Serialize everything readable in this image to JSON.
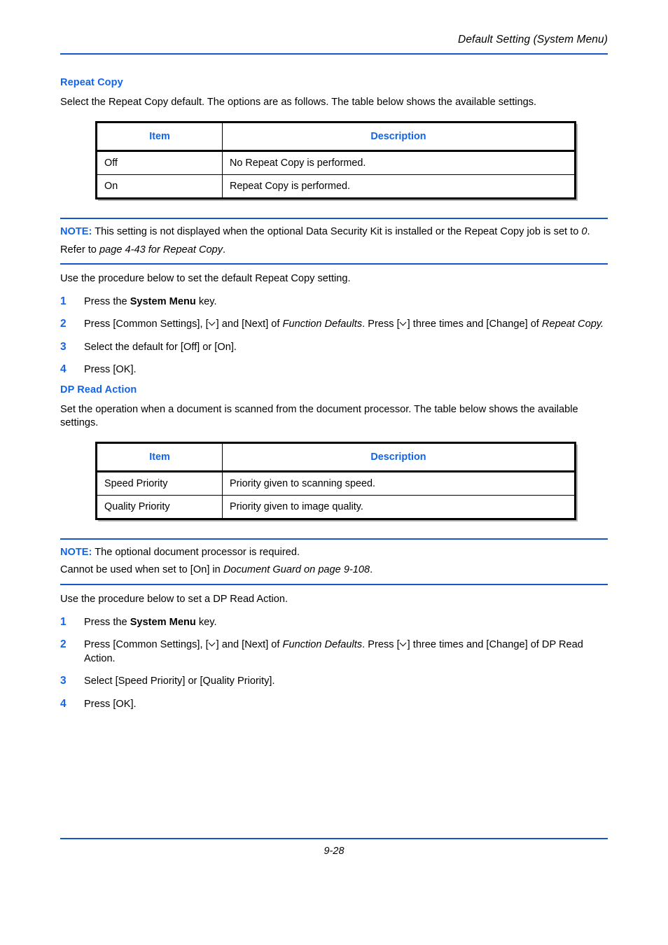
{
  "header": {
    "running_title": "Default Setting (System Menu)"
  },
  "footer": {
    "page_number": "9-28"
  },
  "sections": [
    {
      "heading": "Repeat Copy",
      "intro": "Select the Repeat Copy default. The options are as follows. The table below shows the available settings.",
      "table": {
        "columns": [
          "Item",
          "Description"
        ],
        "rows": [
          [
            "Off",
            "No Repeat Copy is performed."
          ],
          [
            "On",
            "Repeat Copy is performed."
          ]
        ]
      },
      "note": {
        "label": "NOTE:",
        "line1_a": " This setting is not displayed when the optional Data Security Kit is installed or the Repeat Copy job is set to ",
        "line1_italic": "0",
        "line1_b": ".",
        "line2_a": "Refer to ",
        "line2_italic": "page 4-43 for Repeat Copy",
        "line2_b": "."
      },
      "procedure_intro": "Use the procedure below to set the default Repeat Copy setting.",
      "steps": [
        {
          "number": "1",
          "parts": [
            {
              "text": "Press the ",
              "style": "normal"
            },
            {
              "text": "System Menu",
              "style": "bold"
            },
            {
              "text": " key.",
              "style": "normal"
            }
          ]
        },
        {
          "number": "2",
          "parts": [
            {
              "text": "Press [Common Settings], [",
              "style": "normal"
            },
            {
              "text": "",
              "style": "chevron"
            },
            {
              "text": "] and [Next] of ",
              "style": "normal"
            },
            {
              "text": "Function Defaults",
              "style": "italic"
            },
            {
              "text": ". Press [",
              "style": "normal"
            },
            {
              "text": "",
              "style": "chevron"
            },
            {
              "text": "] three times and [Change] of ",
              "style": "normal"
            },
            {
              "text": "Repeat Copy.",
              "style": "italic"
            }
          ]
        },
        {
          "number": "3",
          "parts": [
            {
              "text": "Select the default for [Off] or [On].",
              "style": "normal"
            }
          ]
        },
        {
          "number": "4",
          "parts": [
            {
              "text": "Press [OK].",
              "style": "normal"
            }
          ]
        }
      ]
    },
    {
      "heading": "DP Read Action",
      "intro": "Set the operation when a document is scanned from the document processor. The table below shows the available settings.",
      "table": {
        "columns": [
          "Item",
          "Description"
        ],
        "rows": [
          [
            "Speed Priority",
            "Priority given to scanning speed."
          ],
          [
            "Quality Priority",
            "Priority given to image quality."
          ]
        ]
      },
      "note": {
        "label": "NOTE:",
        "line1_a": " The optional document processor is required.",
        "line1_italic": "",
        "line1_b": "",
        "line2_a": "Cannot be used when set to [On] in ",
        "line2_italic": "Document Guard on page 9-108",
        "line2_b": "."
      },
      "procedure_intro": "Use the procedure below to set a DP Read Action.",
      "steps": [
        {
          "number": "1",
          "parts": [
            {
              "text": "Press the ",
              "style": "normal"
            },
            {
              "text": "System Menu",
              "style": "bold"
            },
            {
              "text": " key.",
              "style": "normal"
            }
          ]
        },
        {
          "number": "2",
          "parts": [
            {
              "text": "Press [Common Settings], [",
              "style": "normal"
            },
            {
              "text": "",
              "style": "chevron"
            },
            {
              "text": "] and [Next] of ",
              "style": "normal"
            },
            {
              "text": "Function Defaults",
              "style": "italic"
            },
            {
              "text": ". Press [",
              "style": "normal"
            },
            {
              "text": "",
              "style": "chevron"
            },
            {
              "text": "] three times and [Change] of DP Read Action.",
              "style": "normal"
            }
          ]
        },
        {
          "number": "3",
          "parts": [
            {
              "text": "Select [Speed Priority] or [Quality Priority].",
              "style": "normal"
            }
          ]
        },
        {
          "number": "4",
          "parts": [
            {
              "text": "Press [OK].",
              "style": "normal"
            }
          ]
        }
      ]
    }
  ],
  "colors": {
    "accent_blue": "#1464E6",
    "rule_blue": "#1458C8",
    "text_black": "#000000"
  }
}
